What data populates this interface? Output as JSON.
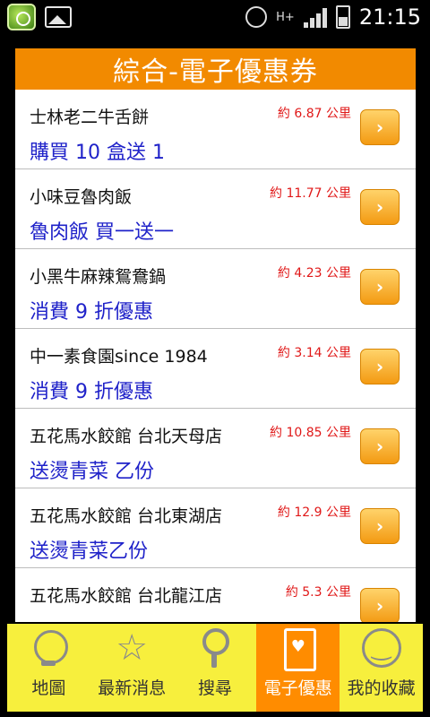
{
  "status_bar": {
    "time": "21:15",
    "network": "H+"
  },
  "header": {
    "title": "綜合-電子優惠券"
  },
  "coupons": [
    {
      "name": "士林老二牛舌餅",
      "distance": "約 6.87 公里",
      "promo": "購買 10 盒送 1"
    },
    {
      "name": "小味豆魯肉飯",
      "distance": "約 11.77 公里",
      "promo": "魯肉飯 買一送一"
    },
    {
      "name": "小黑牛麻辣鴛鴦鍋",
      "distance": "約 4.23 公里",
      "promo": "消費 9 折優惠"
    },
    {
      "name": "中一素食園since 1984",
      "distance": "約 3.14 公里",
      "promo": "消費 9 折優惠"
    },
    {
      "name": "五花馬水餃館 台北天母店",
      "distance": "約 10.85 公里",
      "promo": "送燙青菜 乙份"
    },
    {
      "name": "五花馬水餃館 台北東湖店",
      "distance": "約 12.9 公里",
      "promo": "送燙青菜乙份"
    },
    {
      "name": "五花馬水餃館 台北龍江店",
      "distance": "約 5.3 公里",
      "promo": ""
    }
  ],
  "tabs": [
    {
      "label": "地圖",
      "icon": "globe-icon"
    },
    {
      "label": "最新消息",
      "icon": "star-icon"
    },
    {
      "label": "搜尋",
      "icon": "search-icon"
    },
    {
      "label": "電子優惠",
      "icon": "coupon-icon"
    },
    {
      "label": "我的收藏",
      "icon": "smiley-icon"
    }
  ],
  "colors": {
    "accent": "#f28a00",
    "tabbar": "#f7ef3d",
    "promo_text": "#1f22c9",
    "distance_text": "#e01818"
  }
}
